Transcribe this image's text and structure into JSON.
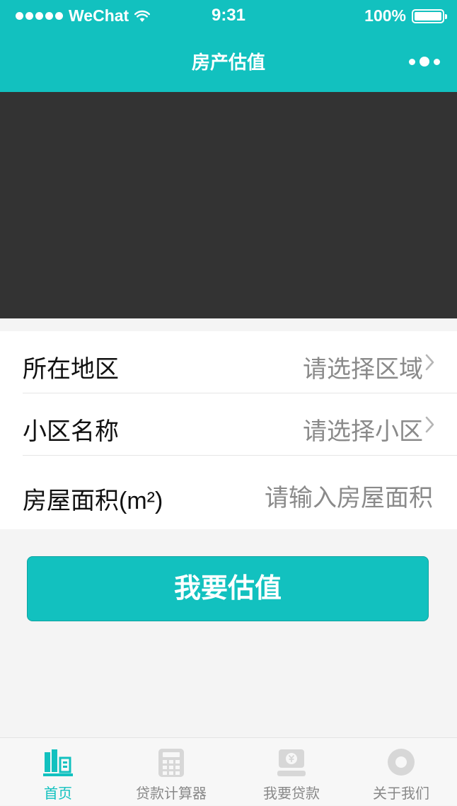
{
  "status_bar": {
    "carrier": "WeChat",
    "time": "9:31",
    "battery": "100%",
    "battery_level": 100
  },
  "nav": {
    "title": "房产估值"
  },
  "form": {
    "rows": [
      {
        "label": "所在地区",
        "value": "请选择区域"
      },
      {
        "label": "小区名称",
        "value": "请选择小区"
      },
      {
        "label": "房屋面积(m²)",
        "placeholder": "请输入房屋面积"
      }
    ]
  },
  "cta": {
    "label": "我要估值"
  },
  "tabbar": {
    "items": [
      {
        "label": "首页",
        "icon": "home-buildings-icon",
        "active": true
      },
      {
        "label": "贷款计算器",
        "icon": "calculator-icon",
        "active": false
      },
      {
        "label": "我要贷款",
        "icon": "loan-icon",
        "active": false
      },
      {
        "label": "关于我们",
        "icon": "about-icon",
        "active": false
      }
    ]
  },
  "colors": {
    "accent": "#12c1bf",
    "banner": "#333333",
    "placeholder": "#8a8a8a",
    "inactive_tab": "#888888"
  }
}
